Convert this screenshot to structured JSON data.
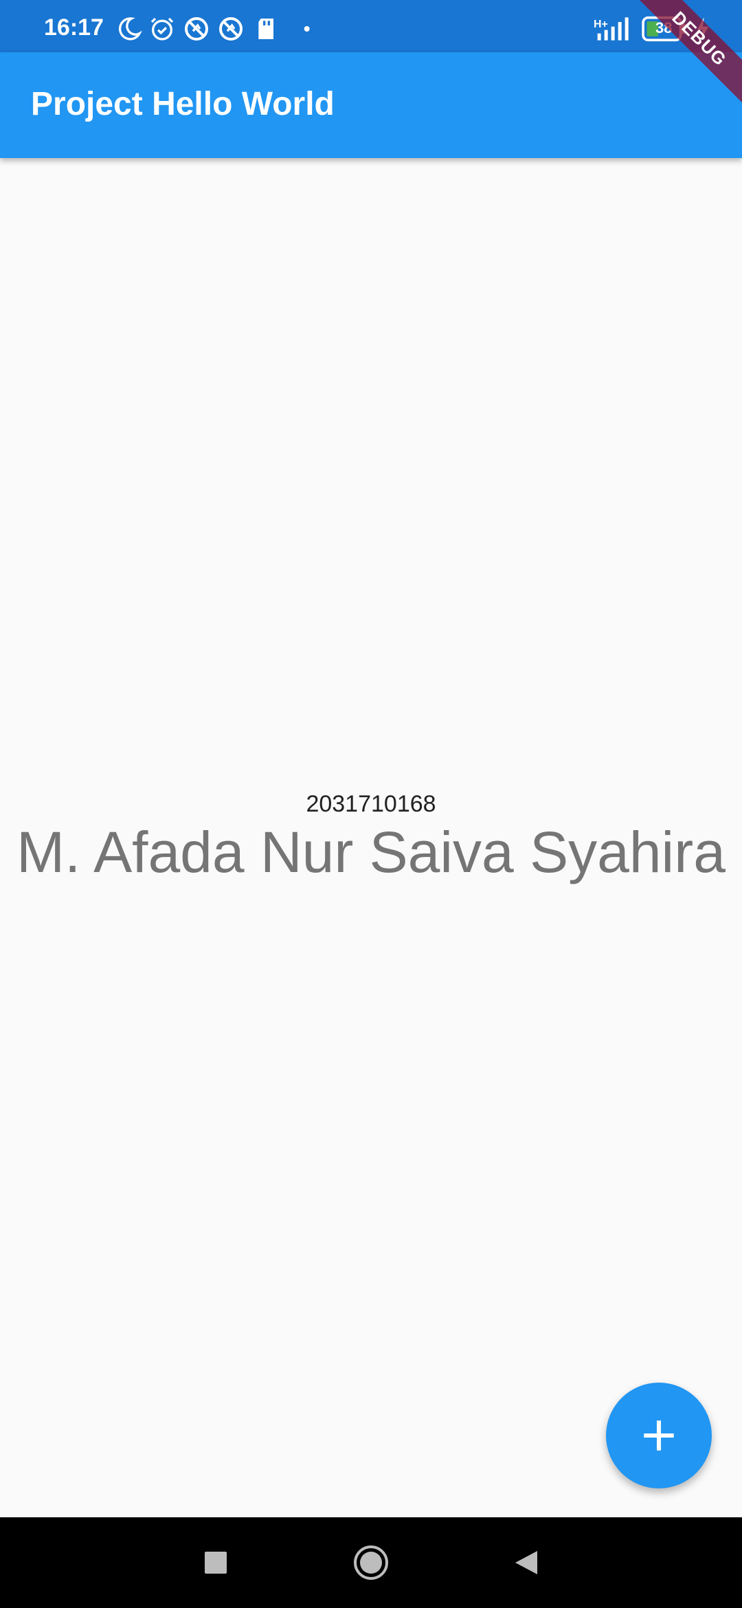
{
  "status_bar": {
    "time": "16:17",
    "network_type": "H+",
    "battery_level": "38",
    "icons": [
      "moon-icon",
      "alarm-icon",
      "sync-blocked-icon",
      "sync-blocked-icon",
      "sd-card-icon",
      "dot-icon",
      "signal-icon",
      "battery-icon",
      "charging-icon"
    ]
  },
  "app_bar": {
    "title": "Project Hello World"
  },
  "debug_banner": {
    "label": "DEBUG"
  },
  "main": {
    "student_id": "2031710168",
    "student_name": "M. Afada Nur Saiva Syahira"
  },
  "fab": {
    "icon": "plus-icon"
  },
  "nav_bar": {
    "buttons": [
      "recents-square-icon",
      "home-circle-icon",
      "back-triangle-icon"
    ]
  },
  "colors": {
    "status_bar": "#1976d2",
    "app_bar": "#2196f3",
    "fab": "#2196f3",
    "background": "#fafafa",
    "nav_bar": "#000000"
  }
}
